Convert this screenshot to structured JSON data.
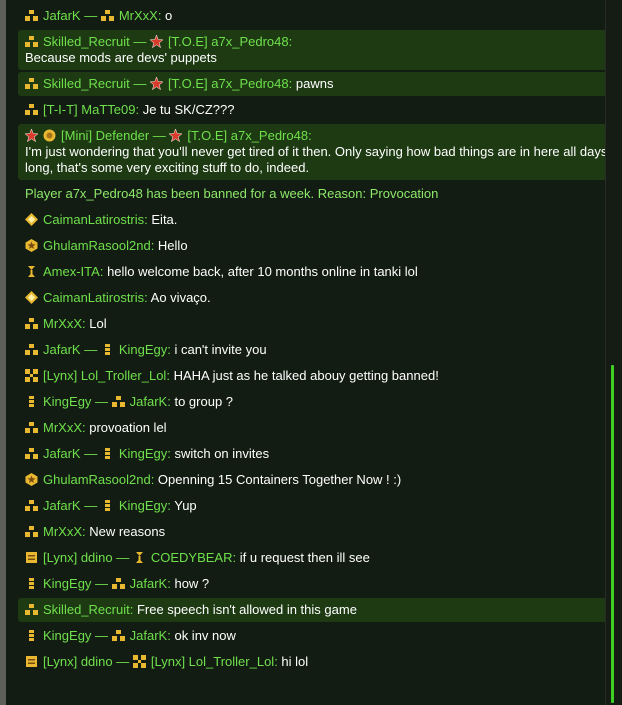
{
  "messages": [
    {
      "icon1": "rank-icon-gold-pips",
      "nick1": "JafarK",
      "sep": " — ",
      "icon2": "rank-icon-gold-pips",
      "nick2": "MrXxX",
      "text": "o",
      "highlight": false
    },
    {
      "icon1": "rank-icon-gold-pips",
      "nick1": "Skilled_Recruit",
      "sep": " — ",
      "icon2": "red-star-icon",
      "nick2": "[T.O.E] a7x_Pedro48",
      "text": "Because mods are devs' puppets",
      "highlight": true,
      "wrap": true
    },
    {
      "icon1": "rank-icon-gold-pips",
      "nick1": "Skilled_Recruit",
      "sep": " — ",
      "icon2": "red-star-icon",
      "nick2": "[T.O.E] a7x_Pedro48",
      "text": "pawns",
      "highlight": true
    },
    {
      "icon1": "rank-icon-gold-pips",
      "nick1": "[T-I-T] MaTTe09",
      "text": "Je tu SK/CZ???",
      "highlight": false
    },
    {
      "icon1": "red-star-icon",
      "icon1b": "gold-medal-icon",
      "nick1": "[Mini] Defender",
      "sep": " — ",
      "icon2": "red-star-icon",
      "nick2": "[T.O.E] a7x_Pedro48",
      "text": "I'm just wondering that you'll never get tired of it then. Only saying how bad things are in here all days long, that's some very exciting stuff to do, indeed.",
      "highlight": true,
      "wrap": true
    },
    {
      "system": "Player a7x_Pedro48 has been banned for a week. Reason: Provocation"
    },
    {
      "icon1": "diamond-rank-icon",
      "nick1": "CaimanLatirostris",
      "text": "Eita."
    },
    {
      "icon1": "star-badge-icon",
      "nick1": "GhulamRasool2nd",
      "text": "Hello"
    },
    {
      "icon1": "gold-chevron-icon",
      "nick1": "Amex-ITA",
      "text": "hello welcome back, after 10 months online in tanki lol"
    },
    {
      "icon1": "diamond-rank-icon",
      "nick1": "CaimanLatirostris",
      "text": "Ao vivaço."
    },
    {
      "icon1": "rank-icon-gold-pips",
      "nick1": "MrXxX",
      "text": "Lol"
    },
    {
      "icon1": "rank-icon-gold-pips",
      "nick1": "JafarK",
      "sep": " — ",
      "icon2": "rank-icon-small",
      "nick2": "KingEgy",
      "text": "i can't invite you"
    },
    {
      "icon1": "rank-icon-quad",
      "nick1": "[Lynx] Lol_Troller_Lol",
      "text": "HAHA just as he talked abouy getting banned!"
    },
    {
      "icon1": "rank-icon-small",
      "nick1": "KingEgy",
      "sep": " — ",
      "icon2": "rank-icon-gold-pips",
      "nick2": "JafarK",
      "text": "to group ?"
    },
    {
      "icon1": "rank-icon-gold-pips",
      "nick1": "MrXxX",
      "text": "provoation lel"
    },
    {
      "icon1": "rank-icon-gold-pips",
      "nick1": "JafarK",
      "sep": " — ",
      "icon2": "rank-icon-small",
      "nick2": "KingEgy",
      "text": "switch on invites"
    },
    {
      "icon1": "star-badge-icon",
      "nick1": "GhulamRasool2nd",
      "text": "Openning 15 Containers Together Now ! :)"
    },
    {
      "icon1": "rank-icon-gold-pips",
      "nick1": "JafarK",
      "sep": " — ",
      "icon2": "rank-icon-small",
      "nick2": "KingEgy",
      "text": "Yup"
    },
    {
      "icon1": "rank-icon-gold-pips",
      "nick1": "MrXxX",
      "text": "New reasons"
    },
    {
      "icon1": "rank-icon-bar",
      "nick1": "[Lynx] ddino",
      "sep": " — ",
      "icon2": "gold-chevron-icon",
      "nick2": "COEDYBEAR",
      "text": "if u request then ill see"
    },
    {
      "icon1": "rank-icon-small",
      "nick1": "KingEgy",
      "sep": " — ",
      "icon2": "rank-icon-gold-pips",
      "nick2": "JafarK",
      "text": "how ?"
    },
    {
      "icon1": "rank-icon-gold-pips",
      "nick1": "Skilled_Recruit",
      "text": "Free speech isn't allowed in this game",
      "highlight": true
    },
    {
      "icon1": "rank-icon-small",
      "nick1": "KingEgy",
      "sep": " — ",
      "icon2": "rank-icon-gold-pips",
      "nick2": "JafarK",
      "text": "ok inv now"
    },
    {
      "icon1": "rank-icon-bar",
      "nick1": "[Lynx] ddino",
      "sep": " — ",
      "icon2": "rank-icon-quad",
      "nick2": "[Lynx] Lol_Troller_Lol",
      "text": "hi lol"
    }
  ],
  "colors": {
    "nick": "#6fe04b",
    "text": "#ffffff",
    "highlight": "#1d3a13",
    "background": "#121c12",
    "scrollbar": "#3fcf22"
  }
}
